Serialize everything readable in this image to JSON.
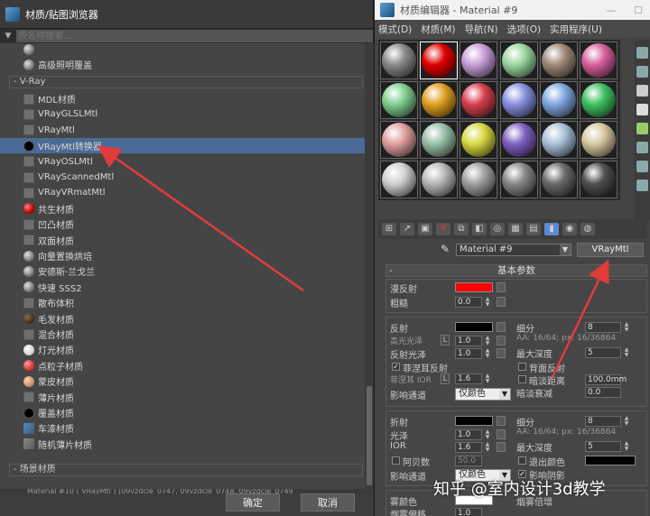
{
  "browser": {
    "title": "材质/贴图浏览器",
    "search_placeholder": "按名称搜索...",
    "top_items": [
      {
        "label": "高级照明覆盖",
        "icon": "sphere"
      }
    ],
    "group_vray": "- V-Ray",
    "vray_items": [
      {
        "label": "MDL材质",
        "icon": "square"
      },
      {
        "label": "VRayGLSLMtl",
        "icon": "square"
      },
      {
        "label": "VRayMtl",
        "icon": "square"
      },
      {
        "label": "VRayMtl转换器",
        "icon": "black",
        "selected": true
      },
      {
        "label": "VRayOSLMtl",
        "icon": "square"
      },
      {
        "label": "VRayScannedMtl",
        "icon": "square"
      },
      {
        "label": "VRayVRmatMtl",
        "icon": "square"
      },
      {
        "label": "共生材质",
        "icon": "red"
      },
      {
        "label": "凹凸材质",
        "icon": "square"
      },
      {
        "label": "双面材质",
        "icon": "square"
      },
      {
        "label": "向量置换烘培",
        "icon": "sphere"
      },
      {
        "label": "安德斯·兰戈兰",
        "icon": "sphere"
      },
      {
        "label": "快速 SSS2",
        "icon": "sphere"
      },
      {
        "label": "散布体积",
        "icon": "square"
      },
      {
        "label": "毛发材质",
        "icon": "brown"
      },
      {
        "label": "混合材质",
        "icon": "square"
      },
      {
        "label": "灯光材质",
        "icon": "white"
      },
      {
        "label": "点粒子材质",
        "icon": "redsphere"
      },
      {
        "label": "蒙皮材质",
        "icon": "pinksphere"
      },
      {
        "label": "薄片材质",
        "icon": "square"
      },
      {
        "label": "覆盖材质",
        "icon": "black"
      },
      {
        "label": "车漆材质",
        "icon": "bluesquare"
      },
      {
        "label": "随机薄片材质",
        "icon": "graysquare"
      }
    ],
    "group_scene": "- 场景材质",
    "scene_line": "Material #10 ( VRayMtl ) [09vzdcle_0747, 09vzdcle_0748, 09vzdcle_0749",
    "ok_label": "确定",
    "cancel_label": "取消"
  },
  "editor": {
    "title": "材质编辑器 - Material #9",
    "menu": [
      "模式(D)",
      "材质(M)",
      "导航(N)",
      "选项(O)",
      "实用程序(U)"
    ],
    "slot_colors": [
      "#8a8a8a",
      "#e00000",
      "#c8a0d8",
      "#9ad8a0",
      "#a08a78",
      "#d860a0",
      "#80d090",
      "#e0a020",
      "#d84050",
      "#8890e0",
      "#80a8e0",
      "#40c060",
      "#e0a0a0",
      "#98c0a8",
      "#d8d840",
      "#8060c0",
      "#a8c0d8",
      "#d8c8a0",
      "#d0d0d0",
      "#b8b8b8",
      "#a0a0a0",
      "#888888",
      "#6a6a6a",
      "#505050"
    ],
    "material_name": "Material #9",
    "material_type": "VRayMtl",
    "rollout_title": "基本参数",
    "diffuse": {
      "label": "漫反射",
      "color": "#ff0000"
    },
    "roughness": {
      "label": "粗糙",
      "value": "0.0"
    },
    "reflection": {
      "label": "反射",
      "color": "#000000",
      "gloss_label": "高光光泽",
      "gloss_value": "1.0",
      "gloss_lock": "L",
      "refl_gloss_label": "反射光泽",
      "refl_gloss_value": "1.0",
      "fresnel_label": "菲涅耳反射",
      "fresnel_ior_label": "菲涅耳 IOR",
      "fresnel_ior_lock": "L",
      "fresnel_ior_value": "1.6",
      "affect_label": "影响通道",
      "affect_value": "仅颜色",
      "subdivs_label": "细分",
      "subdivs_value": "8",
      "aa_text": "AA: 16/64; px: 16/36864",
      "max_depth_label": "最大深度",
      "max_depth_value": "5",
      "backside_label": "背面反射",
      "dim_dist_label": "暗淡距离",
      "dim_dist_value": "100.0mm",
      "dim_falloff_label": "暗淡衰减",
      "dim_falloff_value": "0.0"
    },
    "refraction": {
      "label": "折射",
      "color": "#000000",
      "gloss_label": "光泽",
      "gloss_value": "1.0",
      "ior_label": "IOR",
      "ior_value": "1.6",
      "abbe_label": "阿贝数",
      "abbe_value": "50.0",
      "affect_label": "影响通道",
      "affect_value": "仅颜色",
      "subdivs_label": "细分",
      "subdivs_value": "8",
      "aa_text": "AA: 16/64; px: 16/36864",
      "max_depth_label": "最大深度",
      "max_depth_value": "5",
      "exit_color_label": "退出颜色",
      "affect_shadows_label": "影响阴影"
    },
    "fog": {
      "color_label": "雾颜色",
      "bias_label": "烟雾偏移",
      "mult_label": "烟雾倍增",
      "mult_value": "1.0"
    }
  },
  "watermark": "知乎 @室内设计3d教学"
}
